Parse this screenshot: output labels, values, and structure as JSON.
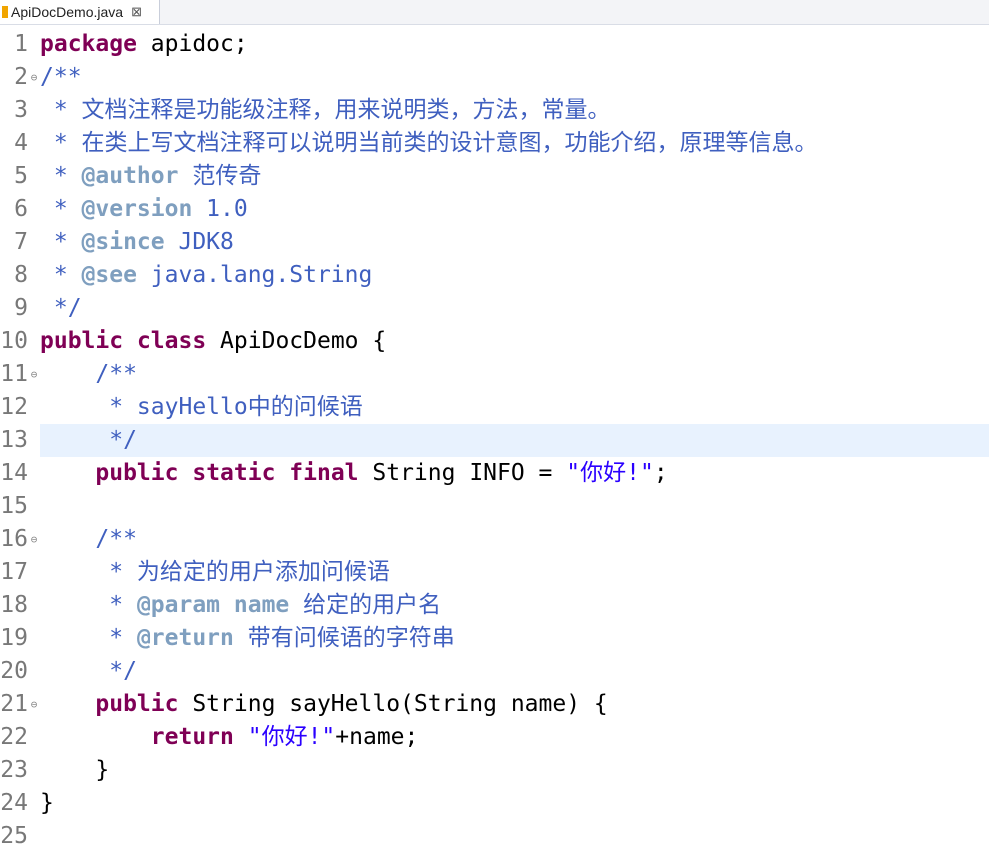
{
  "tab": {
    "title": "ApiDocDemo.java",
    "close_glyph": "⊠"
  },
  "current_line": 13,
  "lines": [
    {
      "n": "1",
      "fold": false,
      "segs": [
        [
          "kw",
          "package"
        ],
        [
          "plain",
          " apidoc;"
        ]
      ]
    },
    {
      "n": "2",
      "fold": true,
      "segs": [
        [
          "jd",
          "/**"
        ]
      ]
    },
    {
      "n": "3",
      "fold": false,
      "segs": [
        [
          "jd",
          " * 文档注释是功能级注释，用来说明类，方法，常量。"
        ]
      ]
    },
    {
      "n": "4",
      "fold": false,
      "segs": [
        [
          "jd",
          " * 在类上写文档注释可以说明当前类的设计意图，功能介绍，原理等信息。"
        ]
      ]
    },
    {
      "n": "5",
      "fold": false,
      "segs": [
        [
          "jd",
          " * "
        ],
        [
          "tag",
          "@author"
        ],
        [
          "jd",
          " 范传奇"
        ]
      ]
    },
    {
      "n": "6",
      "fold": false,
      "segs": [
        [
          "jd",
          " * "
        ],
        [
          "tag",
          "@version"
        ],
        [
          "jd",
          " 1.0"
        ]
      ]
    },
    {
      "n": "7",
      "fold": false,
      "segs": [
        [
          "jd",
          " * "
        ],
        [
          "tag",
          "@since"
        ],
        [
          "jd",
          " JDK8"
        ]
      ]
    },
    {
      "n": "8",
      "fold": false,
      "segs": [
        [
          "jd",
          " * "
        ],
        [
          "tag",
          "@see"
        ],
        [
          "jd",
          " java.lang.String"
        ]
      ]
    },
    {
      "n": "9",
      "fold": false,
      "segs": [
        [
          "jd",
          " */"
        ]
      ]
    },
    {
      "n": "10",
      "fold": false,
      "segs": [
        [
          "kw",
          "public"
        ],
        [
          "plain",
          " "
        ],
        [
          "kw",
          "class"
        ],
        [
          "plain",
          " ApiDocDemo {"
        ]
      ]
    },
    {
      "n": "11",
      "fold": true,
      "segs": [
        [
          "jd",
          "    /**"
        ]
      ]
    },
    {
      "n": "12",
      "fold": false,
      "segs": [
        [
          "jd",
          "     * sayHello中的问候语"
        ]
      ]
    },
    {
      "n": "13",
      "fold": false,
      "segs": [
        [
          "jd",
          "     */"
        ]
      ]
    },
    {
      "n": "14",
      "fold": false,
      "segs": [
        [
          "plain",
          "    "
        ],
        [
          "kw",
          "public"
        ],
        [
          "plain",
          " "
        ],
        [
          "kw",
          "static"
        ],
        [
          "plain",
          " "
        ],
        [
          "kw",
          "final"
        ],
        [
          "plain",
          " String INFO = "
        ],
        [
          "str",
          "\"你好!\""
        ],
        [
          "plain",
          ";"
        ]
      ]
    },
    {
      "n": "15",
      "fold": false,
      "segs": []
    },
    {
      "n": "16",
      "fold": true,
      "segs": [
        [
          "jd",
          "    /**"
        ]
      ]
    },
    {
      "n": "17",
      "fold": false,
      "segs": [
        [
          "jd",
          "     * 为给定的用户添加问候语"
        ]
      ]
    },
    {
      "n": "18",
      "fold": false,
      "segs": [
        [
          "jd",
          "     * "
        ],
        [
          "tag",
          "@param"
        ],
        [
          "jd",
          " "
        ],
        [
          "tagname",
          "name"
        ],
        [
          "jd",
          " 给定的用户名"
        ]
      ]
    },
    {
      "n": "19",
      "fold": false,
      "segs": [
        [
          "jd",
          "     * "
        ],
        [
          "tag",
          "@return"
        ],
        [
          "jd",
          " 带有问候语的字符串"
        ]
      ]
    },
    {
      "n": "20",
      "fold": false,
      "segs": [
        [
          "jd",
          "     */"
        ]
      ]
    },
    {
      "n": "21",
      "fold": true,
      "segs": [
        [
          "plain",
          "    "
        ],
        [
          "kw",
          "public"
        ],
        [
          "plain",
          " String sayHello(String name) {"
        ]
      ]
    },
    {
      "n": "22",
      "fold": false,
      "segs": [
        [
          "plain",
          "        "
        ],
        [
          "kw",
          "return"
        ],
        [
          "plain",
          " "
        ],
        [
          "str",
          "\"你好!\""
        ],
        [
          "plain",
          "+name;"
        ]
      ]
    },
    {
      "n": "23",
      "fold": false,
      "segs": [
        [
          "plain",
          "    }"
        ]
      ]
    },
    {
      "n": "24",
      "fold": false,
      "segs": [
        [
          "plain",
          "}"
        ]
      ]
    },
    {
      "n": "25",
      "fold": false,
      "segs": []
    }
  ],
  "colors": {
    "keyword": "#7f0055",
    "javadoc": "#3f5fbf",
    "javadoc_tag": "#7f9fbf",
    "string": "#2a00ff",
    "current_line_bg": "#e8f2fe"
  },
  "icons": {
    "fold": "collapse-minus-icon",
    "file": "java-file-icon",
    "close": "close-icon"
  }
}
